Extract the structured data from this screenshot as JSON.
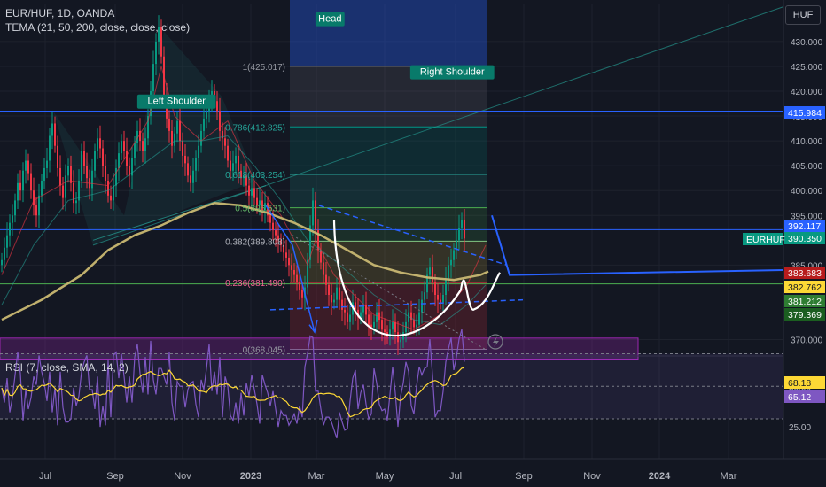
{
  "header": {
    "symbol": "EUR/HUF, 1D, OANDA",
    "indicator": "TEMA (21, 50, 200, close, close, close)"
  },
  "rsi_header": "RSI (7, close, SMA, 14, 2)",
  "currency_button": "HUF",
  "chart_data": {
    "type": "candlestick",
    "x_labels": [
      "Jul",
      "Sep",
      "Nov",
      "2023",
      "Mar",
      "May",
      "Jul",
      "Sep",
      "Nov",
      "2024",
      "Mar"
    ],
    "price_axis": {
      "ticks": [
        "430.000",
        "425.000",
        "420.000",
        "415.000",
        "410.000",
        "405.000",
        "400.000",
        "395.000",
        "385.000",
        "370.000"
      ],
      "ylim": [
        366,
        434
      ]
    },
    "rsi_axis": {
      "ticks": [
        "50.00",
        "25.00"
      ],
      "ylim": [
        0,
        100
      ]
    },
    "price_tags": [
      {
        "value": "415.984",
        "price": 415.984,
        "bg": "#2962ff",
        "fg": "#ffffff"
      },
      {
        "value": "392.117",
        "price": 392.117,
        "bg": "#2962ff",
        "fg": "#ffffff"
      },
      {
        "value": "390.350",
        "price": 390.35,
        "bg": "#089981",
        "fg": "#ffffff"
      },
      {
        "value": "383.683",
        "price": 383.683,
        "bg": "#b71c1c",
        "fg": "#ffffff"
      },
      {
        "value": "382.762",
        "price": 382.762,
        "bg": "#fdd835",
        "fg": "#131722"
      },
      {
        "value": "381.212",
        "price": 381.212,
        "bg": "#2e7d32",
        "fg": "#ffffff"
      },
      {
        "value": "379.369",
        "price": 379.369,
        "bg": "#1b5e20",
        "fg": "#ffffff"
      }
    ],
    "rsi_tags": [
      {
        "value": "68.18",
        "rsi": 68.18,
        "bg": "#fdd835",
        "fg": "#131722"
      },
      {
        "value": "65.12",
        "rsi": 65.12,
        "bg": "#7e57c2",
        "fg": "#ffffff"
      }
    ],
    "symbol_tag": "EURHUF",
    "pattern_labels": [
      {
        "text": "Head",
        "date": "2022-09-30",
        "price": 434.5
      },
      {
        "text": "Right Shoulder",
        "date": "2022-11-20",
        "price": 423.8
      },
      {
        "text": "Left Shoulder",
        "date": "2022-07-28",
        "price": 417.9
      }
    ],
    "fib_levels": [
      {
        "label": "1(425.017)",
        "price": 425.017,
        "color": "#787b86",
        "text_color": "#9598a1"
      },
      {
        "label": "0.786(412.825)",
        "price": 412.825,
        "color": "#009688",
        "text_color": "#26a69a"
      },
      {
        "label": "0.618(403.254)",
        "price": 403.254,
        "color": "#26a69a",
        "text_color": "#26a69a"
      },
      {
        "label": "0.5(396.531)",
        "price": 396.531,
        "color": "#4caf50",
        "text_color": "#66bb6a"
      },
      {
        "label": "0.382(389.808)",
        "price": 389.808,
        "color": "#81c784",
        "text_color": "#b2b5be"
      },
      {
        "label": "0.236(381.490)",
        "price": 381.49,
        "color": "#f23645",
        "text_color": "#f06292"
      },
      {
        "label": "0(368.045)",
        "price": 368.045,
        "color": "#787b86",
        "text_color": "#9598a1"
      }
    ],
    "horizontal_lines": [
      {
        "price": 415.984,
        "color": "#2962ff"
      },
      {
        "price": 392.117,
        "color": "#2962ff"
      },
      {
        "price": 381.212,
        "color": "#4caf50"
      }
    ],
    "projection_path": [
      {
        "date": "2023-08-01",
        "price": 385
      },
      {
        "date": "2023-08-25",
        "price": 403
      },
      {
        "date": "2023-09-25",
        "price": 398
      },
      {
        "date": "2023-10-20",
        "price": 408.5
      },
      {
        "date": "2023-11-15",
        "price": 413.5
      }
    ],
    "target_box": {
      "date_from": "2023-10-05",
      "date_to": "2023-11-27",
      "price_from": 410.5,
      "price_to": 415.3
    },
    "ohlc_start_date": "2022-06-01",
    "close": [
      386.0,
      388.5,
      391.0,
      393.5,
      395.0,
      398.0,
      401.5,
      400.0,
      404.0,
      406.0,
      403.5,
      400.0,
      397.0,
      395.0,
      399.0,
      402.0,
      404.5,
      406.0,
      411.0,
      413.5,
      409.0,
      404.5,
      401.0,
      398.5,
      403.0,
      405.0,
      401.5,
      397.5,
      398.0,
      402.0,
      408.0,
      405.0,
      402.5,
      400.5,
      404.0,
      408.0,
      410.5,
      408.5,
      405.0,
      402.0,
      399.0,
      398.0,
      401.0,
      404.5,
      407.5,
      410.0,
      408.0,
      405.0,
      403.0,
      406.5,
      409.5,
      412.0,
      410.0,
      408.0,
      410.5,
      415.0,
      420.0,
      425.5,
      430.0,
      433.0,
      427.0,
      419.0,
      414.5,
      412.0,
      409.0,
      411.5,
      414.0,
      410.0,
      407.0,
      405.5,
      403.0,
      401.5,
      404.0,
      406.5,
      409.0,
      412.0,
      414.5,
      416.0,
      418.5,
      420.0,
      418.0,
      416.0,
      412.0,
      410.5,
      409.0,
      406.0,
      404.0,
      405.5,
      407.0,
      404.0,
      402.5,
      403.0,
      401.0,
      399.0,
      400.5,
      398.5,
      397.0,
      398.0,
      396.0,
      397.5,
      395.0,
      393.5,
      392.0,
      391.0,
      390.0,
      389.0,
      387.5,
      386.5,
      385.0,
      384.0,
      383.0,
      381.5,
      380.0,
      378.5,
      380.5,
      386.0,
      393.0,
      398.0,
      392.0,
      388.0,
      385.5,
      383.0,
      381.0,
      379.0,
      377.5,
      378.0,
      380.5,
      378.0,
      376.0,
      375.5,
      373.5,
      375.0,
      377.5,
      376.0,
      374.5,
      375.5,
      377.0,
      375.0,
      373.0,
      372.5,
      373.5,
      375.5,
      374.0,
      372.0,
      371.5,
      370.5,
      372.0,
      373.5,
      371.5,
      369.5,
      370.0,
      371.5,
      373.5,
      375.5,
      374.0,
      372.5,
      373.0,
      375.5,
      378.0,
      379.5,
      383.0,
      384.5,
      381.5,
      379.0,
      378.0,
      377.5,
      379.0,
      382.0,
      385.0,
      386.0,
      388.0,
      390.0,
      392.5,
      394.0,
      390.35
    ],
    "tema": [
      {
        "name": "TEMA 21",
        "color": "#f23645",
        "opacity": 0.6,
        "width": 1,
        "points": [
          [
            0,
            383
          ],
          [
            12,
            398
          ],
          [
            25,
            402
          ],
          [
            40,
            401
          ],
          [
            55,
            414
          ],
          [
            60,
            425
          ],
          [
            65,
            415
          ],
          [
            75,
            410
          ],
          [
            85,
            414
          ],
          [
            95,
            402
          ],
          [
            105,
            395
          ],
          [
            115,
            385
          ],
          [
            118,
            390
          ],
          [
            125,
            383
          ],
          [
            140,
            375
          ],
          [
            155,
            372
          ],
          [
            165,
            375
          ],
          [
            175,
            381
          ],
          [
            182,
            389
          ]
        ]
      },
      {
        "name": "TEMA 50",
        "color": "#26a69a",
        "opacity": 0.55,
        "width": 1,
        "points": [
          [
            0,
            377
          ],
          [
            12,
            389
          ],
          [
            25,
            398
          ],
          [
            40,
            400
          ],
          [
            55,
            406
          ],
          [
            65,
            410
          ],
          [
            75,
            410
          ],
          [
            85,
            411
          ],
          [
            95,
            405
          ],
          [
            105,
            398
          ],
          [
            115,
            390
          ],
          [
            125,
            386
          ],
          [
            140,
            379
          ],
          [
            155,
            374
          ],
          [
            165,
            373
          ],
          [
            175,
            377
          ],
          [
            182,
            381
          ]
        ]
      },
      {
        "name": "TEMA 200",
        "color": "#c9b872",
        "opacity": 0.95,
        "width": 2.5,
        "points": [
          [
            0,
            374
          ],
          [
            15,
            378
          ],
          [
            30,
            383
          ],
          [
            40,
            388
          ],
          [
            50,
            391
          ],
          [
            60,
            393
          ],
          [
            70,
            395.5
          ],
          [
            80,
            397.5
          ],
          [
            90,
            397
          ],
          [
            100,
            395.5
          ],
          [
            110,
            393.5
          ],
          [
            120,
            391
          ],
          [
            130,
            388
          ],
          [
            140,
            385
          ],
          [
            150,
            383.5
          ],
          [
            160,
            382.5
          ],
          [
            170,
            382
          ],
          [
            180,
            383
          ],
          [
            183,
            383.7
          ]
        ]
      }
    ],
    "rsi": [
      49.0,
      40.0,
      55.0,
      34.0,
      43.0,
      57.0,
      71.0,
      58.0,
      29.0,
      48.0,
      36.0,
      43.0,
      56.0,
      51.0,
      69.0,
      59.0,
      52.0,
      41.0,
      59.0,
      34.0,
      49.0,
      26.0,
      59.0,
      37.0,
      28.0,
      28.0,
      30.0,
      49.0,
      38.0,
      44.0,
      59.0,
      65.0,
      69.0,
      48.0,
      48.0,
      36.0,
      56.0,
      25.0,
      38.0,
      26.0,
      66.0,
      31.0,
      69.0,
      71.0,
      55.0,
      70.0,
      56.0,
      40.0,
      56.0,
      40.0,
      68.0,
      76.0,
      58.0,
      46.0,
      68.0,
      45.0,
      78.0,
      54.0,
      45.0,
      61.0,
      61.0,
      56.0,
      51.0,
      71.0,
      40.0,
      29.0,
      53.0,
      50.0,
      50.0,
      37.0,
      48.0,
      52.0,
      53.0,
      39.0,
      31.0,
      54.0,
      48.0,
      61.0,
      76.0,
      47.0,
      59.0,
      45.0,
      68.0,
      31.0,
      56.0,
      50.0,
      32.0,
      29.0,
      40.0,
      27.0,
      46.0,
      32.0,
      52.0,
      44.0,
      57.0,
      48.0,
      39.0,
      27.0,
      57.0,
      51.0,
      46.0,
      38.0,
      47.0,
      36.0,
      25.0,
      35.0,
      32.0,
      32.0,
      26.0,
      29.0,
      33.0,
      27.0,
      38.0,
      31.0,
      62.0,
      70.0,
      81.0,
      80.0,
      47.0,
      47.0,
      36.0,
      26.0,
      31.0,
      31.0,
      28.0,
      23.0,
      18.0,
      34.0,
      28.0,
      23.0,
      24.0,
      41.0,
      55.0,
      60.0,
      36.0,
      46.0,
      51.0,
      39.0,
      30.0,
      33.0,
      61.0,
      52.0,
      39.0,
      35.0,
      36.0,
      29.0,
      45.0,
      62.0,
      46.0,
      25.0,
      44.0,
      52.0,
      65.0,
      59.0,
      38.0,
      33.0,
      50.0,
      62.0,
      57.0,
      61.0,
      62.0,
      79.0,
      57.0,
      31.0,
      35.0,
      35.0,
      47.0,
      65.0,
      73.0,
      80.0,
      60.0,
      68.0,
      79.0,
      85.0,
      65.12
    ]
  }
}
